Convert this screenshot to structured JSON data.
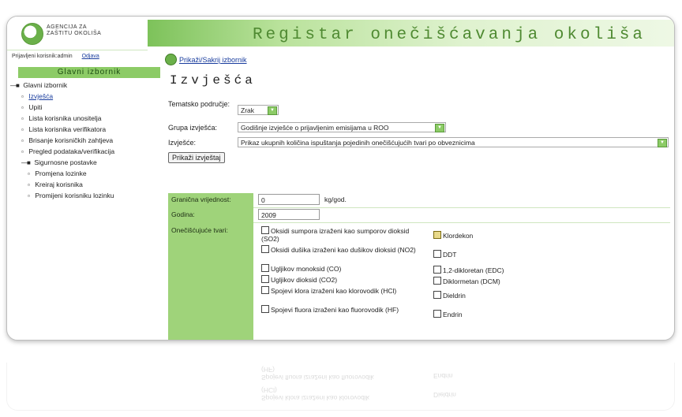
{
  "header": {
    "logo_line1": "AGENCIJA ZA",
    "logo_line2": "ZAŠTITU OKOLIŠA",
    "title": "Registar onečišćavanja okoliša"
  },
  "login": {
    "user_text": "Prijavljeni korisnik:admin",
    "logout": "Odjava"
  },
  "sidebar": {
    "heading": "Glavni izbornik",
    "root": "Glavni izbornik",
    "items": [
      {
        "label": "Izvješća"
      },
      {
        "label": "Upiti"
      },
      {
        "label": "Lista korisnika unositelja"
      },
      {
        "label": "Lista korisnika verifikatora"
      },
      {
        "label": "Brisanje korisničkih zahtjeva"
      },
      {
        "label": "Pregled podataka/verifikacija"
      },
      {
        "label": "Sigurnosne postavke"
      },
      {
        "label": "Promjena lozinke"
      },
      {
        "label": "Kreiraj korisnika"
      },
      {
        "label": "Promijeni korisniku lozinku"
      }
    ]
  },
  "main": {
    "toggle": "Prikaži/Sakrij izbornik",
    "title": "Izvješća",
    "thematic_label": "Tematsko područje:",
    "thematic_value": "Zrak",
    "group_label": "Grupa izvješća:",
    "group_value": "Godišnje izvješće o prijavljenim emisijama u ROO",
    "report_label": "Izvješće:",
    "report_value": "Prikaz ukupnih količina ispuštanja pojedinih onečišćujućih tvari po obveznicima",
    "show_button": "Prikaži izvještaj",
    "threshold_label": "Granična vrijednost:",
    "threshold_value": "0",
    "threshold_unit": "kg/god.",
    "year_label": "Godina:",
    "year_value": "2009",
    "pollutants_label": "Onečišćujuće tvari:",
    "pollutants_left": [
      "Oksidi sumpora izraženi kao sumporov dioksid (SO2)",
      "Oksidi dušika izraženi kao dušikov dioksid (NO2)",
      "Ugljikov monoksid (CO)",
      "Ugljikov dioksid (CO2)",
      "Spojevi klora izraženi kao klorovodik (HCl)",
      "Spojevi fluora izraženi kao fluorovodik (HF)"
    ],
    "pollutants_right": [
      "Klordekon",
      "DDT",
      "1,2-dikloretan (EDC)",
      "Diklormetan (DCM)",
      "Dieldrin",
      "Endrin"
    ]
  },
  "reflection": {
    "line1": "(HF)",
    "line2": "Spojevi fluora izraženi kao fluorovodik",
    "line3": "Endrin",
    "line4": "(HCl)",
    "line5": "Spojevi klora izraženi kao klorovodik",
    "line6": "Dieldrin"
  },
  "colors": {
    "accent_green": "#8ccb66",
    "link_blue": "#1a3d9e"
  }
}
